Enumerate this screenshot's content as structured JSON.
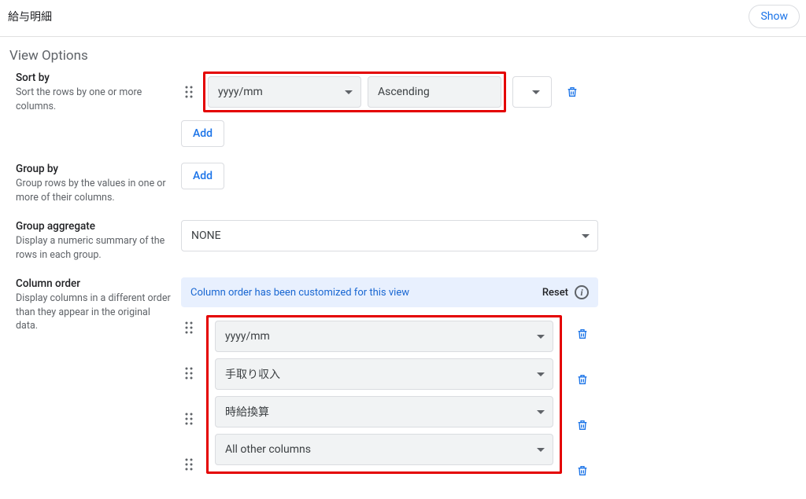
{
  "header": {
    "title": "給与明細",
    "show_label": "Show"
  },
  "section_heading": "View Options",
  "sort_by": {
    "label": "Sort by",
    "desc": "Sort the rows by one or more columns.",
    "column": "yyyy/mm",
    "direction": "Ascending",
    "add_label": "Add"
  },
  "group_by": {
    "label": "Group by",
    "desc": "Group rows by the values in one or more of their columns.",
    "add_label": "Add"
  },
  "group_aggregate": {
    "label": "Group aggregate",
    "desc": "Display a numeric summary of the rows in each group.",
    "value": "NONE"
  },
  "column_order": {
    "label": "Column order",
    "desc": "Display columns in a different order than they appear in the original data.",
    "banner": "Column order has been customized for this view",
    "reset_label": "Reset",
    "items": [
      "yyyy/mm",
      "手取り収入",
      "時給換算",
      "All other columns"
    ]
  }
}
